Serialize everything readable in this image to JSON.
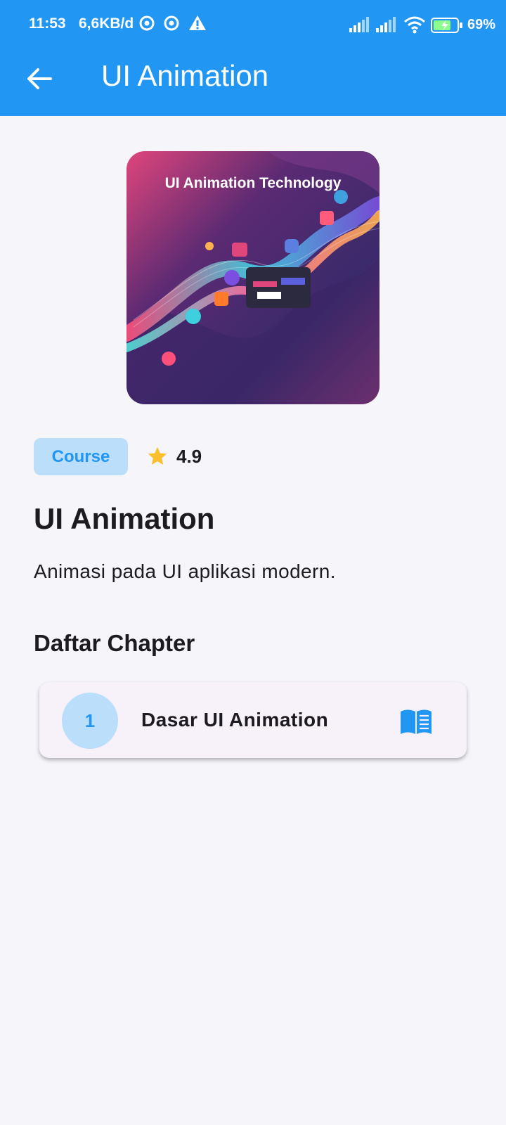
{
  "status_bar": {
    "time": "11:53",
    "speed": "6,6KB/d",
    "battery": "69%"
  },
  "app_bar": {
    "title": "UI Animation",
    "back_icon": "arrow-back-icon"
  },
  "cover": {
    "text": "UI Animation Technology"
  },
  "badge": {
    "label": "Course"
  },
  "rating": {
    "icon": "star-icon",
    "value": "4.9"
  },
  "course": {
    "title": "UI Animation",
    "description": "Animasi pada UI aplikasi modern."
  },
  "chapters": {
    "heading": "Daftar Chapter",
    "items": [
      {
        "number": "1",
        "title": "Dasar UI Animation",
        "icon": "menu-book-icon"
      }
    ]
  },
  "colors": {
    "primary": "#2196f3",
    "badge_bg": "#bbdefb",
    "background": "#f5f5fa",
    "card_bg": "#f7f2fa",
    "star": "#fbc02d"
  }
}
